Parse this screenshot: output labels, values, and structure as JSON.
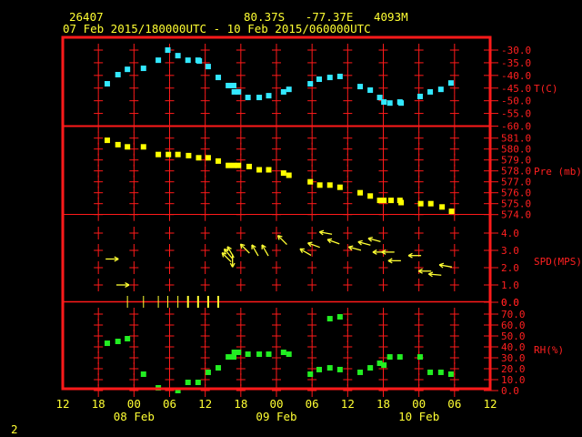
{
  "header": {
    "station": "26407",
    "location": "80.37S   -77.37E   4093M",
    "period": "07 Feb 2015/180000UTC - 10 Feb 2015/060000UTC"
  },
  "footer": {
    "page": "2"
  },
  "colors": {
    "frame": "#ff1a1a",
    "text": "#ffff33",
    "temp": "#33e8ff",
    "pressure": "#ffff00",
    "wind": "#ffff33",
    "rh": "#22ee22",
    "precip": "#ffff33"
  },
  "chart_data": {
    "type": "scatter",
    "time_axis": {
      "unit": "hours since 07 Feb 12UTC",
      "range": [
        0,
        72
      ],
      "tick_labels": [
        "12",
        "18",
        "00",
        "06",
        "12",
        "18",
        "00",
        "06",
        "12",
        "18",
        "00",
        "06",
        "12"
      ],
      "date_labels": [
        {
          "hour": 12,
          "label": "08 Feb"
        },
        {
          "hour": 36,
          "label": "09 Feb"
        },
        {
          "hour": 60,
          "label": "10 Feb"
        }
      ]
    },
    "panels": [
      {
        "id": "temp",
        "label": "T(C)",
        "range": [
          -60,
          -30
        ],
        "ticks": [
          "-30.0",
          "-35.0",
          "-40.0",
          "-45.0",
          "-50.0",
          "-55.0",
          "-60.0"
        ],
        "tick_values": [
          -30,
          -35,
          -40,
          -45,
          -50,
          -55,
          -60
        ],
        "x": [
          7.5,
          9.3,
          10.9,
          13.6,
          16.1,
          17.7,
          19.4,
          21.1,
          22.8,
          23.0,
          24.5,
          26.2,
          27.9,
          28.8,
          28.9,
          29.6,
          31.2,
          33.1,
          34.7,
          37.2,
          38.1,
          41.7,
          43.2,
          45.0,
          46.7,
          50.1,
          51.8,
          53.4,
          54.1,
          55.1,
          56.8,
          57.0,
          60.2,
          61.9,
          63.7,
          65.4
        ],
        "y": [
          -43.3,
          -39.7,
          -37.6,
          -37.2,
          -34.0,
          -30.0,
          -32.2,
          -34.0,
          -34.0,
          -34.3,
          -36.5,
          -40.8,
          -44.0,
          -44.0,
          -46.5,
          -46.5,
          -48.7,
          -48.7,
          -48.0,
          -46.5,
          -45.5,
          -43.3,
          -41.5,
          -40.8,
          -40.4,
          -44.4,
          -45.8,
          -48.7,
          -50.5,
          -50.9,
          -50.5,
          -50.9,
          -48.3,
          -46.5,
          -45.5,
          -43.0
        ]
      },
      {
        "id": "pressure",
        "label": "Pre (mb)",
        "range": [
          574,
          581.9
        ],
        "ticks": [
          "581.0",
          "580.0",
          "579.0",
          "578.0",
          "577.0",
          "576.0",
          "575.0",
          "574.0"
        ],
        "tick_values": [
          581,
          580,
          579,
          578,
          577,
          576,
          575,
          574
        ],
        "x": [
          7.5,
          9.3,
          10.9,
          13.6,
          16.1,
          17.8,
          19.4,
          21.2,
          22.9,
          24.5,
          26.2,
          27.9,
          28.8,
          29.6,
          31.4,
          33.1,
          34.7,
          37.2,
          38.1,
          41.7,
          43.3,
          45.0,
          46.7,
          50.1,
          51.8,
          53.4,
          54.1,
          55.3,
          56.8,
          57.0,
          60.3,
          62.0,
          63.9,
          65.5
        ],
        "y": [
          580.8,
          580.4,
          580.2,
          580.2,
          579.5,
          579.5,
          579.5,
          579.4,
          579.2,
          579.2,
          578.9,
          578.5,
          578.5,
          578.5,
          578.4,
          578.1,
          578.1,
          577.8,
          577.6,
          577.0,
          576.7,
          576.7,
          576.5,
          576.0,
          575.7,
          575.3,
          575.3,
          575.3,
          575.3,
          575.1,
          575.0,
          575.0,
          574.7,
          574.3
        ]
      },
      {
        "id": "wind",
        "label": "SPD(MPS)",
        "range": [
          0,
          4.5
        ],
        "ticks": [
          "4.0",
          "3.0",
          "2.0",
          "1.0",
          "0.0"
        ],
        "tick_values": [
          4,
          3,
          2,
          1,
          0
        ],
        "x": [
          8.3,
          10.1,
          27.6,
          27.9,
          28.3,
          28.6,
          30.7,
          32.4,
          34.1,
          37.0,
          40.9,
          42.3,
          44.3,
          45.6,
          49.2,
          50.8,
          52.5,
          53.3,
          54.8,
          55.9,
          59.3,
          61.0,
          62.7,
          64.5
        ],
        "speed": [
          2.5,
          1.0,
          2.6,
          2.8,
          2.9,
          2.4,
          3.1,
          3.0,
          3.0,
          3.6,
          2.9,
          3.3,
          4.0,
          3.5,
          3.1,
          3.4,
          3.6,
          2.9,
          2.9,
          2.4,
          2.7,
          1.8,
          1.6,
          2.1
        ],
        "toward_deg": [
          90,
          90,
          315,
          320,
          330,
          180,
          315,
          330,
          330,
          315,
          300,
          290,
          280,
          290,
          285,
          285,
          285,
          270,
          270,
          270,
          270,
          270,
          275,
          280
        ]
      },
      {
        "id": "rh",
        "label": "RH(%)",
        "range": [
          0,
          75
        ],
        "ticks": [
          "70.0",
          "60.0",
          "50.0",
          "40.0",
          "30.0",
          "20.0",
          "10.0",
          "0.0"
        ],
        "tick_values": [
          70,
          60,
          50,
          40,
          30,
          20,
          10,
          0
        ],
        "x": [
          7.5,
          9.3,
          10.9,
          13.6,
          16.1,
          19.4,
          21.1,
          22.8,
          24.5,
          26.2,
          27.9,
          28.8,
          28.9,
          29.6,
          31.2,
          33.1,
          34.7,
          37.2,
          38.1,
          41.7,
          43.2,
          45.0,
          46.7,
          45.0,
          46.7,
          50.1,
          51.8,
          53.4,
          54.1,
          55.1,
          56.8,
          60.2,
          61.9,
          63.7,
          65.4
        ],
        "y": [
          43.3,
          45.0,
          47.5,
          15.0,
          2.5,
          0.0,
          7.5,
          7.5,
          16.7,
          20.8,
          30.8,
          30.8,
          35.0,
          35.0,
          33.3,
          33.3,
          33.3,
          35.0,
          33.3,
          15.0,
          19.2,
          20.8,
          19.2,
          65.8,
          67.5,
          16.7,
          20.8,
          25.0,
          23.3,
          30.8,
          30.8,
          30.8,
          16.7,
          16.7,
          15.0
        ]
      }
    ],
    "precip": {
      "label": "0.0",
      "x": [
        10.9,
        13.6,
        16.1,
        17.7,
        19.4,
        21.1,
        22.8,
        24.5,
        26.2
      ],
      "strong": [
        false,
        false,
        false,
        false,
        false,
        true,
        true,
        true,
        true
      ]
    }
  }
}
